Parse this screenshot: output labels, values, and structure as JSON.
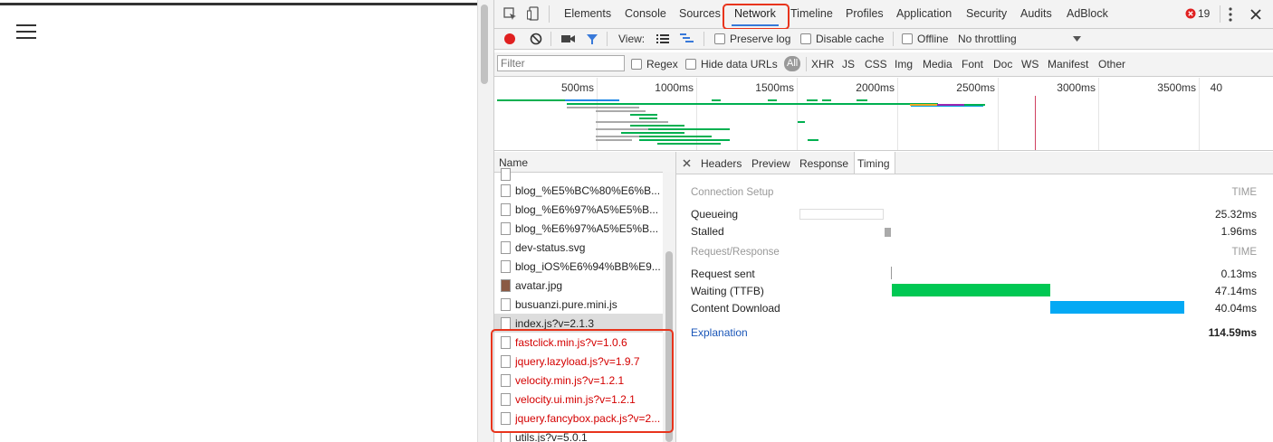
{
  "devtools": {
    "tabs": [
      "Elements",
      "Console",
      "Sources",
      "Network",
      "Timeline",
      "Profiles",
      "Application",
      "Security",
      "Audits",
      "AdBlock"
    ],
    "active_tab": "Network",
    "error_count": "19",
    "toolbar": {
      "view_label": "View:",
      "preserve_log": "Preserve log",
      "disable_cache": "Disable cache",
      "offline": "Offline",
      "throttling": "No throttling"
    },
    "filter": {
      "placeholder": "Filter",
      "regex": "Regex",
      "hide_data_urls": "Hide data URLs",
      "all": "All",
      "types": [
        "XHR",
        "JS",
        "CSS",
        "Img",
        "Media",
        "Font",
        "Doc",
        "WS",
        "Manifest",
        "Other"
      ]
    },
    "overview": {
      "ticks": [
        "500ms",
        "1000ms",
        "1500ms",
        "2000ms",
        "2500ms",
        "3000ms",
        "3500ms",
        "40"
      ]
    },
    "name_header": "Name",
    "requests": [
      {
        "name": "blog_%E5%BC%80%E6%B...",
        "style": "normal"
      },
      {
        "name": "blog_%E6%97%A5%E5%B...",
        "style": "normal"
      },
      {
        "name": "blog_%E6%97%A5%E5%B...",
        "style": "normal"
      },
      {
        "name": "dev-status.svg",
        "style": "normal"
      },
      {
        "name": "blog_iOS%E6%94%BB%E9...",
        "style": "normal"
      },
      {
        "name": "avatar.jpg",
        "style": "normal"
      },
      {
        "name": "busuanzi.pure.mini.js",
        "style": "normal"
      },
      {
        "name": "index.js?v=2.1.3",
        "style": "selected"
      },
      {
        "name": "fastclick.min.js?v=1.0.6",
        "style": "red"
      },
      {
        "name": "jquery.lazyload.js?v=1.9.7",
        "style": "red"
      },
      {
        "name": "velocity.min.js?v=1.2.1",
        "style": "red"
      },
      {
        "name": "velocity.ui.min.js?v=1.2.1",
        "style": "red"
      },
      {
        "name": "jquery.fancybox.pack.js?v=2...",
        "style": "red"
      },
      {
        "name": "utils.js?v=5.0.1",
        "style": "normal"
      }
    ],
    "detail": {
      "tabs": [
        "Headers",
        "Preview",
        "Response",
        "Timing"
      ],
      "active_tab": "Timing",
      "connection_setup": "Connection Setup",
      "time_header": "TIME",
      "queueing": {
        "label": "Queueing",
        "value": "25.32ms"
      },
      "stalled": {
        "label": "Stalled",
        "value": "1.96ms"
      },
      "request_response": "Request/Response",
      "request_sent": {
        "label": "Request sent",
        "value": "0.13ms"
      },
      "waiting": {
        "label": "Waiting (TTFB)",
        "value": "47.14ms"
      },
      "content_download": {
        "label": "Content Download",
        "value": "40.04ms"
      },
      "explanation": "Explanation",
      "total": "114.59ms"
    },
    "colors": {
      "accent": "#3879d9",
      "highlight": "#e8341c",
      "waiting": "#00c853",
      "download": "#03a9f4",
      "record": "#e02020",
      "error_text": "#d40000"
    }
  }
}
